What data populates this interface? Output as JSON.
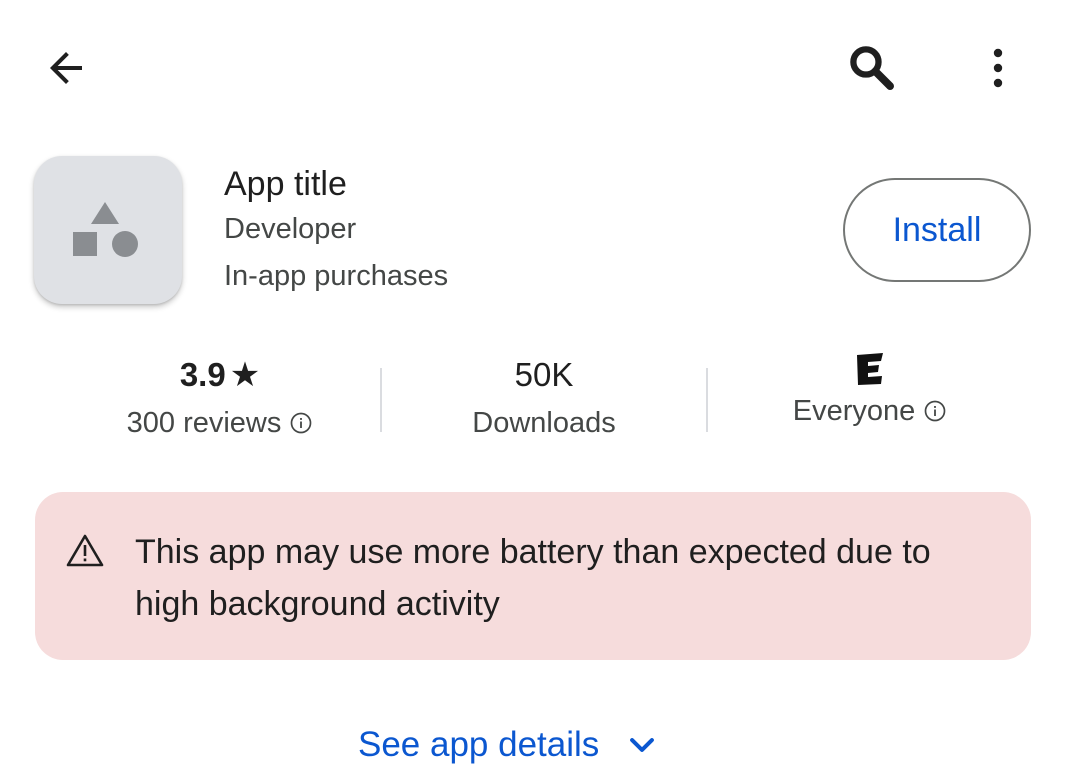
{
  "toolbar": {
    "back_icon": "arrow-back-icon",
    "search_icon": "search-icon",
    "more_icon": "more-vert-icon"
  },
  "app": {
    "icon": "shapes-placeholder-icon",
    "title": "App title",
    "developer": "Developer",
    "purchases": "In-app purchases",
    "install_label": "Install"
  },
  "stats": {
    "rating": {
      "value": "3.9",
      "star": "★",
      "label": "300 reviews"
    },
    "downloads": {
      "value": "50K",
      "label": "Downloads"
    },
    "content_rating": {
      "value_icon": "esrb-everyone-icon",
      "label": "Everyone"
    }
  },
  "warning": {
    "icon": "warning-triangle-icon",
    "text": "This app may use more battery than expected due to high background activity"
  },
  "details": {
    "label": "See app details",
    "icon": "chevron-down-icon"
  },
  "colors": {
    "accent": "#0b57d0",
    "warning_bg": "#f6dcdc",
    "icon_bg": "#dfe1e5",
    "text_primary": "#1f1f1f",
    "text_secondary": "#444746"
  }
}
